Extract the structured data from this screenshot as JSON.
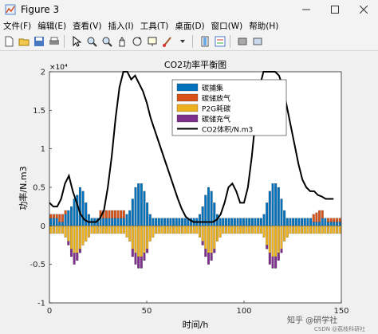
{
  "window": {
    "title": "Figure 3",
    "controls": [
      "minimize-icon",
      "maximize-icon",
      "close-icon"
    ]
  },
  "menu": [
    "文件(F)",
    "编辑(E)",
    "查看(V)",
    "插入(I)",
    "工具(T)",
    "桌面(D)",
    "窗口(W)",
    "帮助(H)"
  ],
  "toolbar_icons": [
    "new-figure-icon",
    "open-file-icon",
    "save-icon",
    "print-icon",
    "pointer-icon",
    "zoom-in-icon",
    "zoom-out-icon",
    "pan-icon",
    "rotate-icon",
    "data-cursor-icon",
    "brush-icon",
    "colorbar-icon",
    "legend-icon",
    "hide-plot-tools-icon",
    "show-plot-tools-icon"
  ],
  "chart_data": {
    "type": "bar",
    "title": "CO2功率平衡图",
    "xlabel": "时间/h",
    "ylabel": "功率/N.m3",
    "exponent_label": "×10⁴",
    "xlim": [
      0,
      150
    ],
    "ylim": [
      -1,
      2
    ],
    "xticks": [
      "0",
      "50",
      "100",
      "150"
    ],
    "yticks": [
      "-1",
      "-0.5",
      "0",
      "0.5",
      "1",
      "1.5",
      "2"
    ],
    "units_scale": 10000,
    "legend_position": "top-right",
    "colors": {
      "碳捕集": "#0072bd",
      "碳储放气": "#d95319",
      "P2G耗碳": "#edb120",
      "碳储充气": "#7e2f8e",
      "CO2体积/N.m3": "#000000"
    },
    "bar_series": [
      {
        "name": "碳捕集",
        "values": [
          0.1,
          0.1,
          0.1,
          0.05,
          0.05,
          0.15,
          0.2,
          0.25,
          0.35,
          0.4,
          0.5,
          0.45,
          0.3,
          0.15,
          0.1,
          0.1,
          0.1,
          0.1,
          0.1,
          0.1,
          0.1,
          0.1,
          0.1,
          0.1,
          0.1,
          0.1,
          0.15,
          0.2,
          0.35,
          0.5,
          0.55,
          0.55,
          0.45,
          0.3,
          0.15,
          0.1,
          0.1,
          0.1,
          0.1,
          0.1,
          0.1,
          0.1,
          0.1,
          0.1,
          0.1,
          0.1,
          0.1,
          0.1,
          0.1,
          0.1,
          0.1,
          0.15,
          0.25,
          0.4,
          0.5,
          0.45,
          0.3,
          0.15,
          0.1,
          0.1,
          0.1,
          0.1,
          0.1,
          0.1,
          0.1,
          0.1,
          0.1,
          0.1,
          0.1,
          0.1,
          0.1,
          0.1,
          0.1,
          0.15,
          0.3,
          0.45,
          0.55,
          0.55,
          0.5,
          0.35,
          0.2,
          0.1,
          0.1,
          0.1,
          0.1,
          0.1,
          0.1,
          0.1,
          0.1,
          0.1,
          0.05,
          0.05,
          0.05,
          0.1,
          0.1,
          0.05,
          0.05,
          0.05,
          0.05,
          0.05
        ]
      },
      {
        "name": "碳储放气",
        "values": [
          0.05,
          0.05,
          0.05,
          0.1,
          0.1,
          0.05,
          0.0,
          0.0,
          0.0,
          0.0,
          0.0,
          0.0,
          0.0,
          0.0,
          0.0,
          0.0,
          0.0,
          0.1,
          0.1,
          0.1,
          0.1,
          0.1,
          0.1,
          0.1,
          0.1,
          0.1,
          0.0,
          0.0,
          0.0,
          0.0,
          0.0,
          0.0,
          0.0,
          0.0,
          0.0,
          0.0,
          0.0,
          0.0,
          0.0,
          0.0,
          0.0,
          0.0,
          0.0,
          0.0,
          0.0,
          0.0,
          0.0,
          0.0,
          0.0,
          0.0,
          0.0,
          0.0,
          0.0,
          0.0,
          0.0,
          0.0,
          0.0,
          0.0,
          0.0,
          0.0,
          0.0,
          0.0,
          0.0,
          0.0,
          0.0,
          0.0,
          0.0,
          0.0,
          0.0,
          0.0,
          0.0,
          0.0,
          0.0,
          0.0,
          0.0,
          0.0,
          0.0,
          0.0,
          0.0,
          0.0,
          0.0,
          0.0,
          0.0,
          0.0,
          0.0,
          0.0,
          0.0,
          0.0,
          0.0,
          0.0,
          0.1,
          0.12,
          0.15,
          0.1,
          0.0,
          0.05,
          0.05,
          0.05,
          0.05,
          0.05
        ]
      },
      {
        "name": "P2G耗碳",
        "values": [
          -0.1,
          -0.1,
          -0.1,
          -0.1,
          -0.1,
          -0.15,
          -0.2,
          -0.3,
          -0.35,
          -0.35,
          -0.3,
          -0.25,
          -0.2,
          -0.15,
          -0.1,
          -0.1,
          -0.1,
          -0.1,
          -0.1,
          -0.1,
          -0.1,
          -0.1,
          -0.1,
          -0.1,
          -0.1,
          -0.1,
          -0.15,
          -0.2,
          -0.3,
          -0.35,
          -0.4,
          -0.4,
          -0.35,
          -0.3,
          -0.2,
          -0.15,
          -0.1,
          -0.1,
          -0.1,
          -0.1,
          -0.1,
          -0.1,
          -0.1,
          -0.1,
          -0.1,
          -0.1,
          -0.1,
          -0.1,
          -0.1,
          -0.1,
          -0.1,
          -0.15,
          -0.2,
          -0.3,
          -0.35,
          -0.35,
          -0.3,
          -0.2,
          -0.15,
          -0.1,
          -0.1,
          -0.1,
          -0.1,
          -0.1,
          -0.1,
          -0.1,
          -0.1,
          -0.1,
          -0.1,
          -0.1,
          -0.1,
          -0.1,
          -0.1,
          -0.15,
          -0.25,
          -0.35,
          -0.4,
          -0.4,
          -0.35,
          -0.3,
          -0.2,
          -0.15,
          -0.1,
          -0.1,
          -0.1,
          -0.1,
          -0.1,
          -0.1,
          -0.1,
          -0.1,
          -0.1,
          -0.1,
          -0.1,
          -0.1,
          -0.1,
          -0.1,
          -0.1,
          -0.1,
          -0.1,
          -0.1
        ]
      },
      {
        "name": "碳储充气",
        "values": [
          0.0,
          0.0,
          0.0,
          0.0,
          0.0,
          0.0,
          -0.05,
          -0.1,
          -0.15,
          -0.1,
          -0.05,
          0.0,
          0.0,
          0.0,
          0.0,
          0.0,
          0.0,
          0.0,
          0.0,
          0.0,
          0.0,
          0.0,
          0.0,
          0.0,
          0.0,
          0.0,
          0.0,
          0.0,
          -0.1,
          -0.15,
          -0.15,
          -0.15,
          -0.1,
          -0.05,
          0.0,
          0.0,
          0.0,
          0.0,
          0.0,
          0.0,
          0.0,
          0.0,
          0.0,
          0.0,
          0.0,
          0.0,
          0.0,
          0.0,
          0.0,
          0.0,
          0.0,
          0.0,
          -0.05,
          -0.1,
          -0.15,
          -0.1,
          -0.05,
          0.0,
          0.0,
          0.0,
          0.0,
          0.0,
          0.0,
          0.0,
          0.0,
          0.0,
          0.0,
          0.0,
          0.0,
          0.0,
          0.0,
          0.0,
          0.0,
          0.0,
          -0.05,
          -0.15,
          -0.15,
          -0.15,
          -0.1,
          -0.05,
          0.0,
          0.0,
          0.0,
          0.0,
          0.0,
          0.0,
          0.0,
          0.0,
          0.0,
          0.0,
          0.0,
          0.0,
          0.0,
          0.0,
          0.0,
          0.0,
          0.0,
          0.0,
          0.0,
          0.0
        ]
      }
    ],
    "line_series": {
      "name": "CO2体积/N.m3",
      "x": [
        0,
        2,
        4,
        6,
        8,
        10,
        12,
        14,
        16,
        18,
        20,
        22,
        24,
        26,
        28,
        30,
        32,
        34,
        36,
        38,
        40,
        42,
        44,
        46,
        48,
        50,
        52,
        54,
        56,
        58,
        60,
        62,
        64,
        66,
        68,
        70,
        72,
        74,
        76,
        78,
        80,
        82,
        84,
        86,
        88,
        90,
        92,
        94,
        96,
        98,
        100,
        102,
        104,
        106,
        108,
        110,
        112,
        114,
        116,
        118,
        120,
        122,
        124,
        126,
        128,
        130,
        132,
        134,
        136,
        138,
        140,
        142,
        144,
        146
      ],
      "y": [
        0.3,
        0.25,
        0.25,
        0.35,
        0.55,
        0.65,
        0.45,
        0.3,
        0.15,
        0.08,
        0.05,
        0.05,
        0.05,
        0.1,
        0.2,
        0.5,
        0.9,
        1.4,
        1.8,
        2.0,
        2.0,
        1.9,
        1.95,
        1.85,
        1.75,
        1.6,
        1.4,
        1.25,
        1.1,
        0.95,
        0.8,
        0.65,
        0.5,
        0.35,
        0.22,
        0.12,
        0.08,
        0.05,
        0.05,
        0.05,
        0.05,
        0.05,
        0.05,
        0.08,
        0.15,
        0.3,
        0.5,
        0.55,
        0.45,
        0.3,
        0.3,
        0.5,
        0.9,
        1.4,
        1.8,
        2.0,
        2.0,
        2.0,
        2.0,
        1.95,
        1.8,
        1.55,
        1.3,
        1.05,
        0.8,
        0.6,
        0.5,
        0.45,
        0.45,
        0.4,
        0.38,
        0.35,
        0.35,
        0.35
      ]
    }
  },
  "watermark": {
    "main": "知乎 @研学社",
    "sub": "CSDN @荔枝科研社"
  }
}
